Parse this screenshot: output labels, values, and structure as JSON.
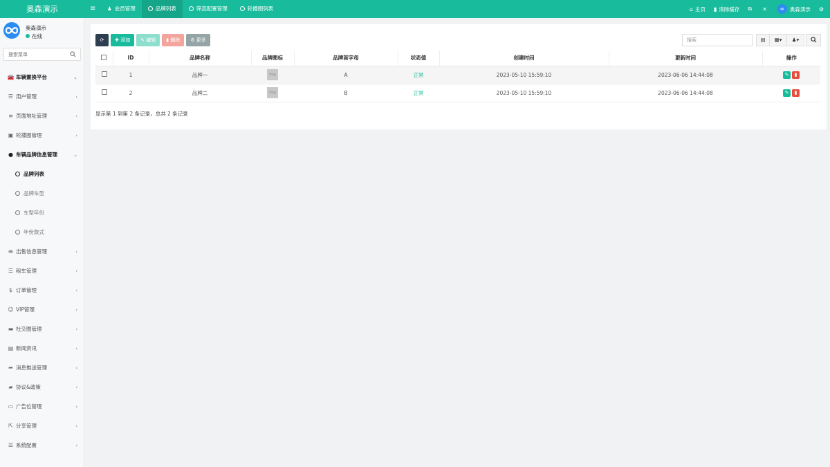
{
  "app": {
    "brand": "奥森演示",
    "menu_toggle_icon": "hamburger-icon"
  },
  "tabs": [
    {
      "label": "会员管理",
      "icon": "user-icon"
    },
    {
      "label": "品牌列表",
      "icon": "circle-icon",
      "active": true
    },
    {
      "label": "筛选配置管理",
      "icon": "circle-icon"
    },
    {
      "label": "轮播图列表",
      "icon": "circle-icon"
    }
  ],
  "topright": {
    "home": "主页",
    "clear_cache": "清除缓存",
    "username": "奥森演示"
  },
  "user": {
    "name": "奥森演示",
    "status": "在线",
    "status_color": "#18bc9c"
  },
  "search": {
    "placeholder": "搜索菜单"
  },
  "menu": {
    "platform": "车辆置换平台",
    "user_mgmt": "用户管理",
    "page_addr": "页面地址管理",
    "carousel": "轮播图管理",
    "brand_info": "车辆品牌信息管理",
    "brand_list": "品牌列表",
    "brand_model": "品牌车型",
    "model_year": "车型年份",
    "year_style": "年份款式",
    "sale_info": "出售信息管理",
    "rental": "租车管理",
    "orders": "订单管理",
    "vip": "VIP管理",
    "social": "社交圈管理",
    "news": "新闻资讯",
    "push": "消息推送管理",
    "agreement": "协议&政策",
    "ads": "广告位管理",
    "share": "分享管理",
    "sysconf": "系统配置"
  },
  "toolbar": {
    "add": "添加",
    "edit": "编辑",
    "delete": "删除",
    "more": "更多"
  },
  "table_search": {
    "placeholder": "搜索"
  },
  "table": {
    "columns": [
      "ID",
      "品牌名称",
      "品牌图标",
      "品牌首字母",
      "状态值",
      "创建时间",
      "更新时间",
      "操作"
    ],
    "rows": [
      {
        "id": "1",
        "name": "品牌一",
        "letter": "A",
        "status": "正常",
        "created": "2023-05-10 15:59:10",
        "updated": "2023-06-06 14:44:08"
      },
      {
        "id": "2",
        "name": "品牌二",
        "letter": "B",
        "status": "正常",
        "created": "2023-05-10 15:59:10",
        "updated": "2023-06-06 14:44:08"
      }
    ]
  },
  "pagination": {
    "info": "显示第 1 到第 2 条记录，总共 2 条记录"
  },
  "colors": {
    "accent": "#18bc9c",
    "danger": "#e74c3c",
    "dark": "#2c3e50",
    "avatar": "#2d8cf0"
  }
}
